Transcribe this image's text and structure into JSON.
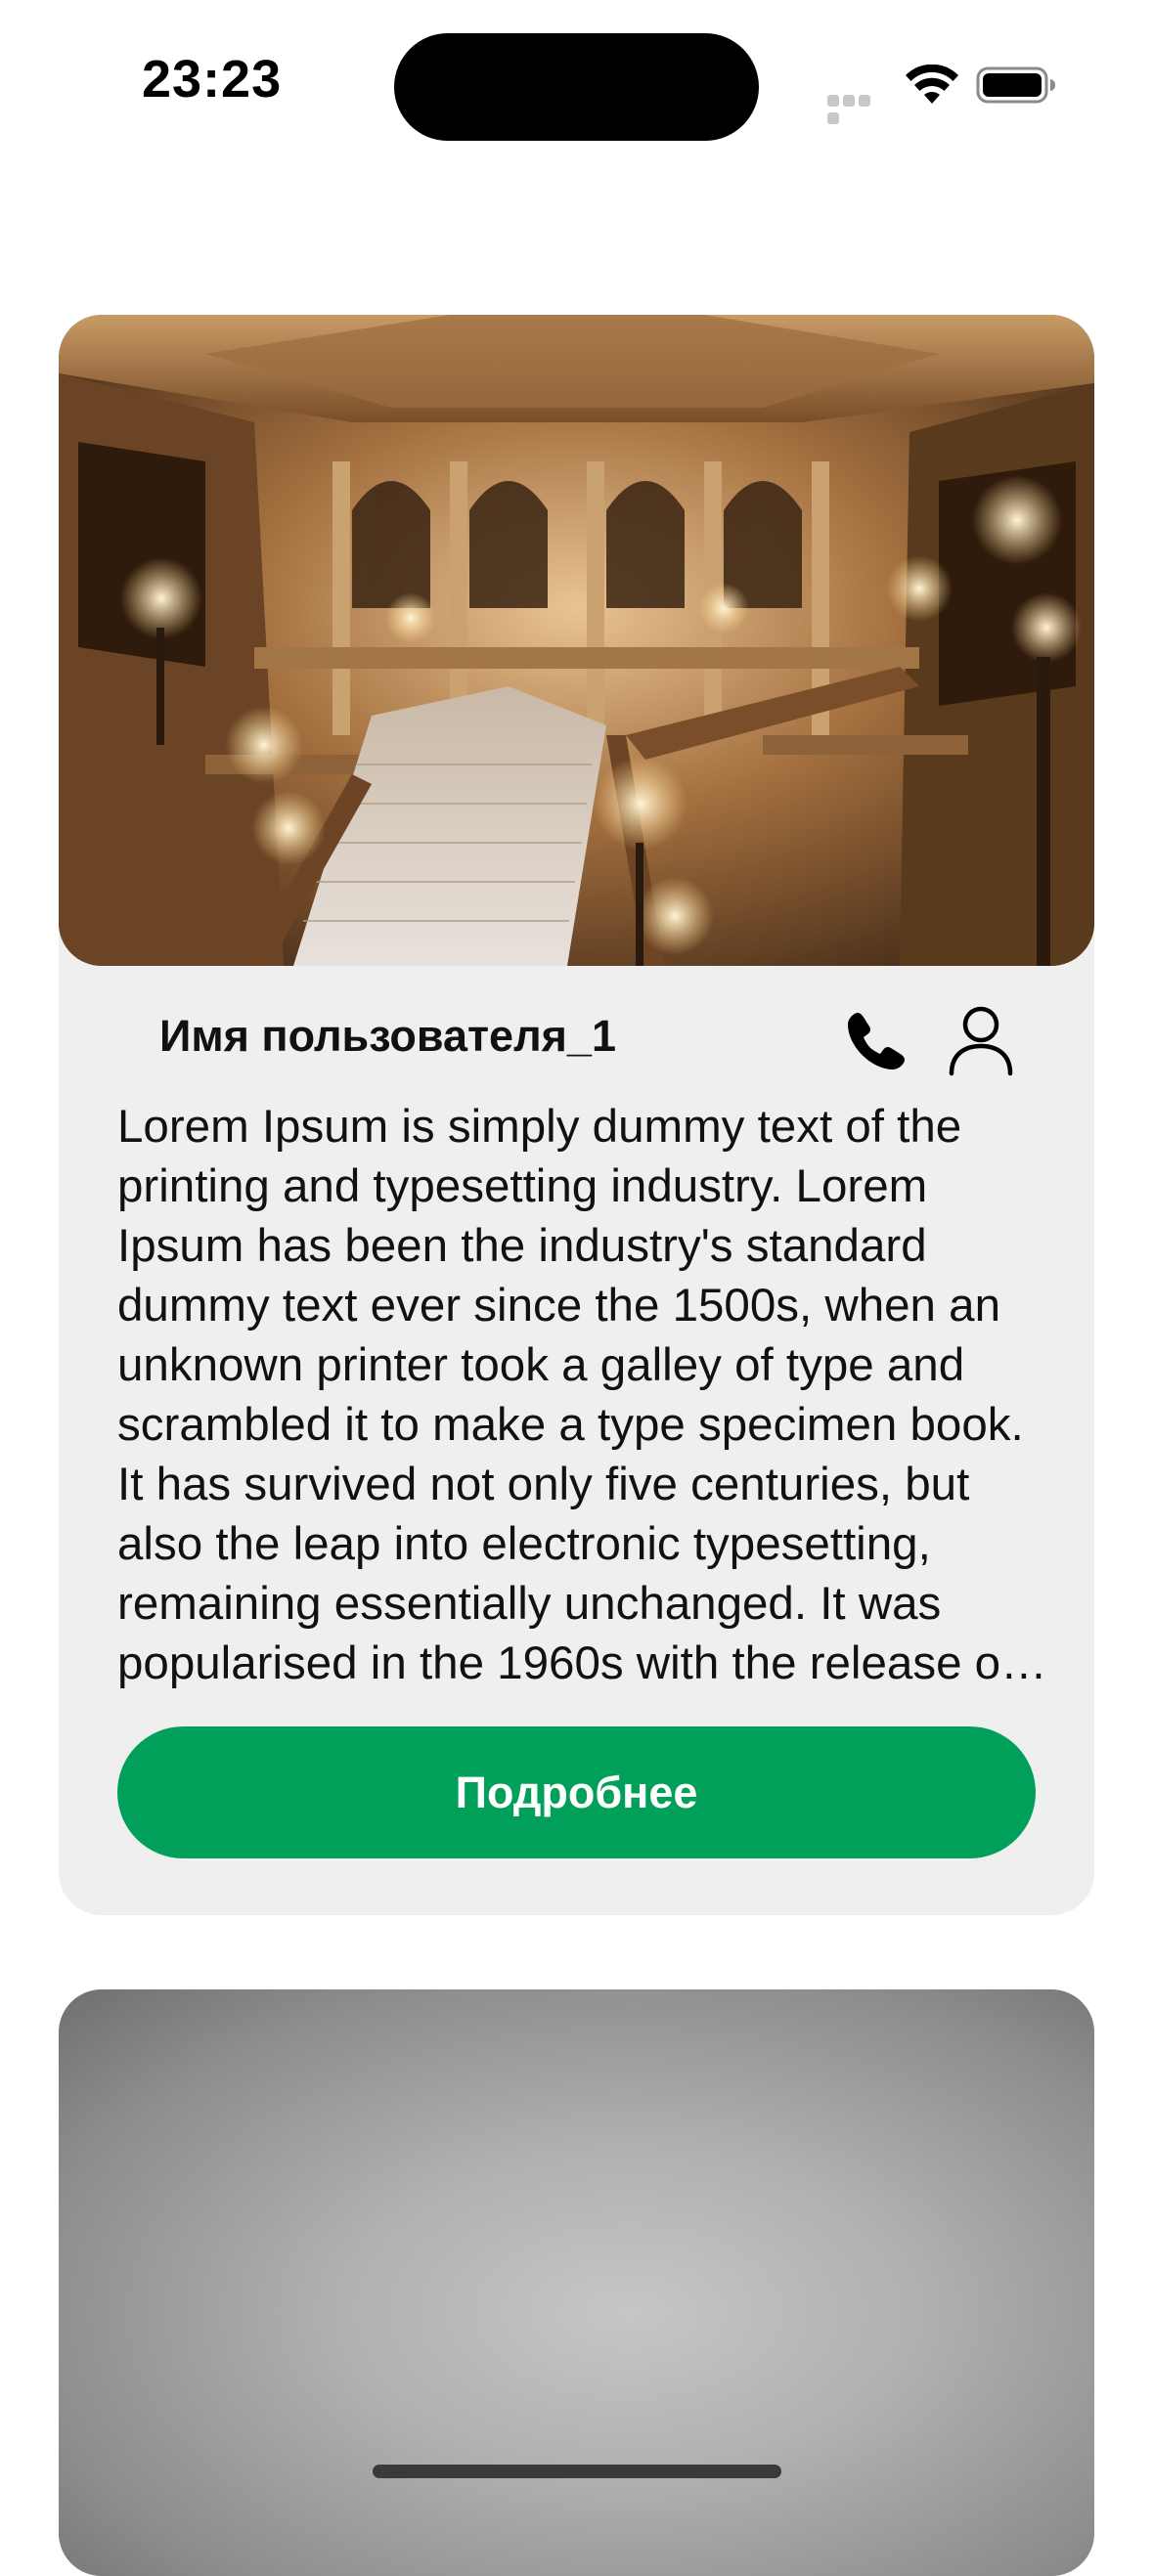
{
  "status_bar": {
    "time": "23:23",
    "icons": [
      "cellular-signal-icon",
      "wifi-icon",
      "battery-icon"
    ]
  },
  "cards": [
    {
      "image": "opera-grand-staircase-photo",
      "username": "Имя пользователя_1",
      "description": "Lorem Ipsum is simply dummy text of the printing and typesetting industry. Lorem Ipsum has been the industry's standard dummy text ever since the 1500s, when an unknown printer took a galley of type and scrambled it to make a type specimen book. It has survived not only five centuries, but also the leap into electronic typesetting, remaining essentially unchanged. It was popularised in the 1960s with the release of Letraset sheets containing Lorem Ipsum passages.",
      "actions": [
        "phone-icon",
        "person-icon"
      ],
      "button_label": "Подробнее"
    },
    {
      "image": "gray-gradient-photo"
    }
  ],
  "colors": {
    "accent": "#00a05a",
    "card_background": "#efefef",
    "page_background": "#ffffff"
  }
}
